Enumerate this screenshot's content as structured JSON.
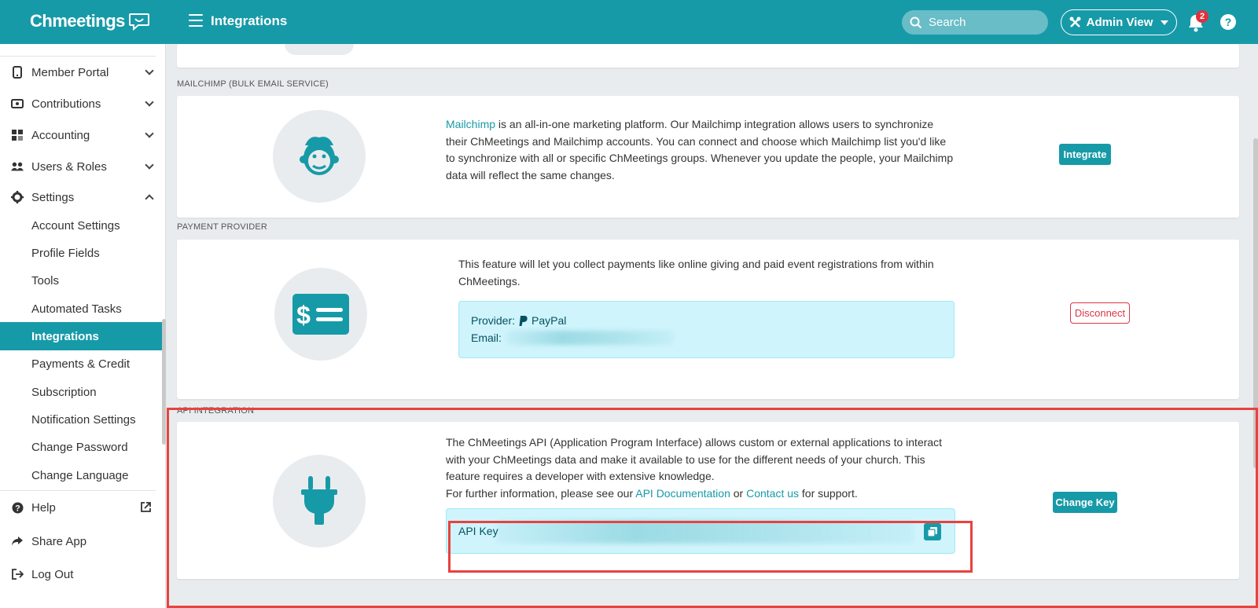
{
  "header": {
    "logo": "Chmeetings",
    "page_title": "Integrations",
    "search_placeholder": "Search",
    "admin_view_label": "Admin View",
    "notification_count": "2",
    "help_label": "?"
  },
  "sidebar": {
    "items": [
      {
        "label": "Member Portal",
        "icon": "mobile-icon"
      },
      {
        "label": "Contributions",
        "icon": "money-icon"
      },
      {
        "label": "Accounting",
        "icon": "grid-icon"
      },
      {
        "label": "Users & Roles",
        "icon": "users-icon"
      },
      {
        "label": "Settings",
        "icon": "gear-icon"
      }
    ],
    "settings_sub": [
      "Account Settings",
      "Profile Fields",
      "Tools",
      "Automated Tasks",
      "Integrations",
      "Payments & Credit",
      "Subscription",
      "Notification Settings",
      "Change Password",
      "Change Language"
    ],
    "bottom": [
      {
        "label": "Help",
        "icon": "question-icon"
      },
      {
        "label": "Share App",
        "icon": "share-icon"
      },
      {
        "label": "Log Out",
        "icon": "logout-icon"
      }
    ]
  },
  "sections": {
    "mailchimp": {
      "label": "MAILCHIMP (BULK EMAIL SERVICE)",
      "link": "Mailchimp",
      "text": " is an all-in-one marketing platform. Our Mailchimp integration allows users to synchronize their ChMeetings and Mailchimp accounts. You can connect and choose which Mailchimp list you'd like to synchronize with all or specific ChMeetings groups. Whenever you update the people, your Mailchimp data will reflect the same changes.",
      "button": "Integrate"
    },
    "payment": {
      "label": "PAYMENT PROVIDER",
      "text": "This feature will let you collect payments like online giving and paid event registrations from within ChMeetings.",
      "provider_label": "Provider:",
      "provider_value": "PayPal",
      "email_label": "Email:",
      "button": "Disconnect"
    },
    "api": {
      "label": "API INTEGRATION",
      "text": "The ChMeetings API (Application Program Interface) allows custom or external applications to interact with your ChMeetings data and make it available to use for the different needs of your church. This feature requires a developer with extensive knowledge.",
      "further_prefix": "For further information, please see our ",
      "doc_link": "API Documentation",
      "or_text": " or ",
      "contact_link": "Contact us",
      "support_suffix": " for support.",
      "key_label": "API Key",
      "button": "Change Key"
    }
  },
  "colors": {
    "brand": "#179aa8",
    "danger": "#dc3545",
    "highlight": "#e8423f"
  }
}
